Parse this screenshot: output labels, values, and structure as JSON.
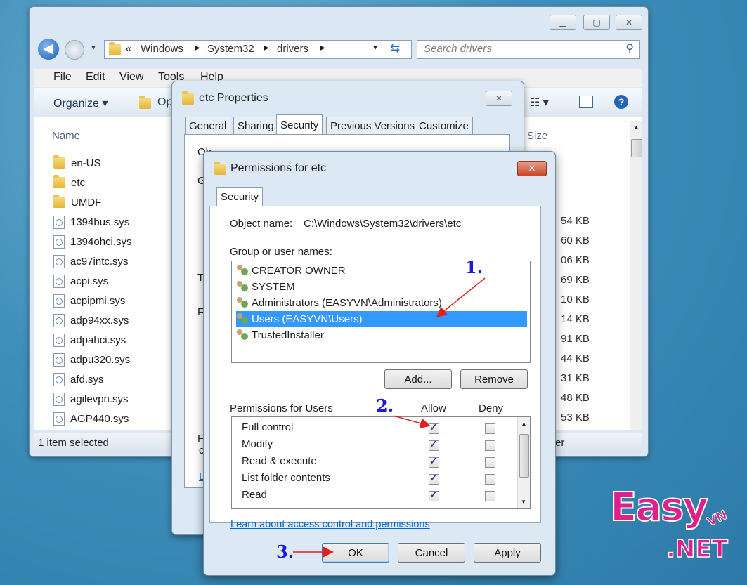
{
  "explorer": {
    "address": {
      "sep": "«",
      "crumbs": [
        "Windows",
        "System32",
        "drivers"
      ]
    },
    "search_placeholder": "Search drivers",
    "menu": [
      "File",
      "Edit",
      "View",
      "Tools",
      "Help"
    ],
    "toolbar": {
      "organize": "Organize ▾",
      "open": "Op"
    },
    "column_name": "Name",
    "column_size": "Size",
    "items": [
      {
        "name": "en-US",
        "type": "folder"
      },
      {
        "name": "etc",
        "type": "folder"
      },
      {
        "name": "UMDF",
        "type": "folder"
      },
      {
        "name": "1394bus.sys",
        "type": "file",
        "size": "54 KB"
      },
      {
        "name": "1394ohci.sys",
        "type": "file",
        "size": "60 KB"
      },
      {
        "name": "ac97intc.sys",
        "type": "file",
        "size": "06 KB"
      },
      {
        "name": "acpi.sys",
        "type": "file",
        "size": "69 KB"
      },
      {
        "name": "acpipmi.sys",
        "type": "file",
        "size": "10 KB"
      },
      {
        "name": "adp94xx.sys",
        "type": "file",
        "size": "14 KB"
      },
      {
        "name": "adpahci.sys",
        "type": "file",
        "size": "91 KB"
      },
      {
        "name": "adpu320.sys",
        "type": "file",
        "size": "44 KB"
      },
      {
        "name": "afd.sys",
        "type": "file",
        "size": "31 KB"
      },
      {
        "name": "agilevpn.sys",
        "type": "file",
        "size": "48 KB"
      },
      {
        "name": "AGP440.sys",
        "type": "file",
        "size": "53 KB"
      }
    ],
    "status": "1 item selected",
    "status_right": "er"
  },
  "props": {
    "title": "etc Properties",
    "tabs": [
      "General",
      "Sharing",
      "Security",
      "Previous Versions",
      "Customize"
    ],
    "active_tab": "Security",
    "object_peek": "Ob",
    "frag_1": "G",
    "frag_2": "T",
    "frag_3": "F",
    "frag_4": "F",
    "frag_5": "c",
    "frag_6": "L"
  },
  "perm": {
    "title": "Permissions for etc",
    "tab": "Security",
    "object_label": "Object name:",
    "object_value": "C:\\Windows\\System32\\drivers\\etc",
    "group_label": "Group or user names:",
    "users": [
      "CREATOR OWNER",
      "SYSTEM",
      "Administrators (EASYVN\\Administrators)",
      "Users (EASYVN\\Users)",
      "TrustedInstaller"
    ],
    "selected_user": 3,
    "add": "Add...",
    "remove": "Remove",
    "perm_label": "Permissions for Users",
    "allow": "Allow",
    "deny": "Deny",
    "permissions": [
      {
        "name": "Full control",
        "allow": true,
        "deny": false
      },
      {
        "name": "Modify",
        "allow": true,
        "deny": false
      },
      {
        "name": "Read & execute",
        "allow": true,
        "deny": false
      },
      {
        "name": "List folder contents",
        "allow": true,
        "deny": false
      },
      {
        "name": "Read",
        "allow": true,
        "deny": false
      }
    ],
    "link": "Learn about access control and permissions",
    "ok": "OK",
    "cancel": "Cancel",
    "apply": "Apply"
  },
  "annotations": {
    "step1": "1.",
    "step2": "2.",
    "step3": "3."
  },
  "watermark": {
    "easy": "Easy",
    "vn": "VN",
    "net": ".NET"
  },
  "colors": {
    "selection": "#3399ff",
    "annotation": "#1a1ad8",
    "arrow": "#e02020",
    "brand_pink": "#e0208a"
  }
}
